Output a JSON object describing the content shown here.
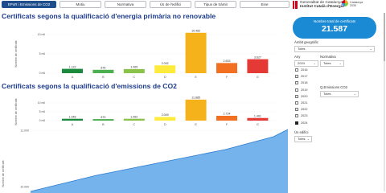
{
  "nav": {
    "tabs": [
      {
        "label": "EPoR i Emissions de CO2",
        "active": true
      },
      {
        "label": "Motiu",
        "active": false
      },
      {
        "label": "Normativa",
        "active": false
      },
      {
        "label": "Ús de l'edifici",
        "active": false
      },
      {
        "label": "Tipus de tràmit",
        "active": false
      },
      {
        "label": "Eine",
        "active": false
      }
    ]
  },
  "brand": {
    "line1": "Generalitat de Catalunya",
    "line2": "Institut Català d'Energia",
    "logo2_line1": "Catalunya",
    "logo2_line2": "2030"
  },
  "colors": {
    "accent": "#1a8ad4",
    "title": "#1c3b8c",
    "A": "#1b8a3c",
    "B": "#4caf50",
    "C": "#8bc34a",
    "D": "#ffeb3b",
    "E": "#f5b21b",
    "F": "#f36f21",
    "G": "#e53935",
    "area": "#74b3ec"
  },
  "chart_data": [
    {
      "type": "bar",
      "title": "Certificats segons la qualificació d'energia primària no renovable",
      "ylabel": "Nombre de certificats",
      "categories": [
        "A",
        "B",
        "C",
        "D",
        "E",
        "F",
        "G"
      ],
      "values": [
        1122,
        876,
        1065,
        2032,
        10462,
        2633,
        3627
      ],
      "data_labels": [
        "1.122",
        "876",
        "1.065",
        "2.032",
        "10.462",
        "2.633",
        "3.627"
      ],
      "ylim": [
        0,
        10000
      ],
      "yticks": [
        0,
        5000,
        10000
      ],
      "ytick_labels": [
        "0 mil",
        "5 mil",
        "10 mil"
      ]
    },
    {
      "type": "bar",
      "title": "Certificats segons la qualificació d'emissions de CO2",
      "ylabel": "Nombre de certificats",
      "categories": [
        "A",
        "B",
        "C",
        "D",
        "E",
        "F",
        "G"
      ],
      "values": [
        1048,
        879,
        1062,
        2049,
        11885,
        2734,
        1491
      ],
      "data_labels": [
        "1.048",
        "879",
        "1.062",
        "2.049",
        "11.885",
        "2.734",
        "1.491"
      ],
      "ylim": [
        0,
        10000
      ],
      "yticks": [
        0,
        5000,
        10000
      ],
      "ytick_labels": [
        "0 mil",
        "5 mil",
        "10 mil"
      ]
    },
    {
      "type": "area",
      "ylabel": "Nombre de certificats",
      "yticks": [
        10000,
        11000
      ],
      "ytick_labels": [
        "10.000",
        "11.000"
      ],
      "y": [
        9700,
        11000
      ]
    }
  ],
  "kpi": {
    "label": "Nombre total de certificats",
    "value": "21.587"
  },
  "slicers": {
    "ambit_label": "Àmbit geogràfic",
    "ambit_value": "Totes",
    "any_label": "Any",
    "any_value": "2024",
    "normativa_label": "Normativa",
    "normativa_value": "Totes",
    "emissions_label": "Q.Emissions CO2",
    "emissions_value": "Totes",
    "us_label": "Ús edifici",
    "us_value": "Totes",
    "years": [
      {
        "label": "2016",
        "checked": false
      },
      {
        "label": "2017",
        "checked": false
      },
      {
        "label": "2018",
        "checked": false
      },
      {
        "label": "2019",
        "checked": false
      },
      {
        "label": "2020",
        "checked": false
      },
      {
        "label": "2021",
        "checked": false
      },
      {
        "label": "2022",
        "checked": false
      },
      {
        "label": "2023",
        "checked": false
      },
      {
        "label": "2024",
        "checked": true
      }
    ]
  }
}
